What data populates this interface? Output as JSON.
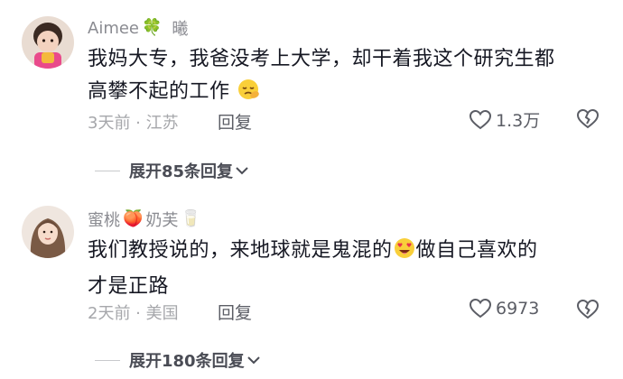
{
  "comments": [
    {
      "username": "Aimee",
      "username_emoji": "🍀",
      "username_suffix": "曦",
      "text_line1": "我妈大专，我爸没考上大学，却干着我这个研究生都",
      "text_line2": "高攀不起的工作",
      "inline_emoji": "tired-face-emoji",
      "time_location": "3天前 · 江苏",
      "reply_label": "回复",
      "like_count": "1.3万",
      "expand_label": "展开85条回复"
    },
    {
      "username": "蜜桃",
      "username_emoji": "🍑",
      "username_suffix": "奶芙",
      "username_emoji2": "🥛",
      "text_line1_a": "我们教授说的，来地球就是鬼混的",
      "inline_emoji": "heart-eyes-emoji",
      "text_line1_b": "做自己喜欢的",
      "text_line2": "才是正路",
      "time_location": "2天前 · 美国",
      "reply_label": "回复",
      "like_count": "6973",
      "expand_label": "展开180条回复"
    }
  ],
  "colors": {
    "primary_text": "#161823",
    "secondary_text": "#a6a7ab",
    "username": "#8a8b91",
    "action": "#5b5d65"
  }
}
